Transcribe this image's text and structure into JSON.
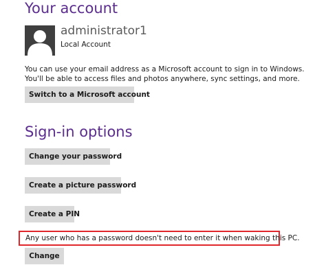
{
  "account": {
    "heading": "Your account",
    "username": "administrator1",
    "account_type": "Local Account",
    "avatar_icon": "user-silhouette-icon",
    "description": "You can use your email address as a Microsoft account to sign in to Windows. You'll be able to access files and photos anywhere, sync settings, and more.",
    "switch_label": "Switch to a Microsoft account"
  },
  "signin": {
    "heading": "Sign-in options",
    "change_password_label": "Change your password",
    "picture_password_label": "Create a picture password",
    "pin_label": "Create a PIN",
    "wake_notice": "Any user who has a password doesn't need to enter it when waking this PC.",
    "change_label": "Change"
  },
  "colors": {
    "heading": "#5b2d8e",
    "button": "#d9d9d9",
    "highlight_border": "#e0262b",
    "avatar_background": "#3f3f3f"
  }
}
